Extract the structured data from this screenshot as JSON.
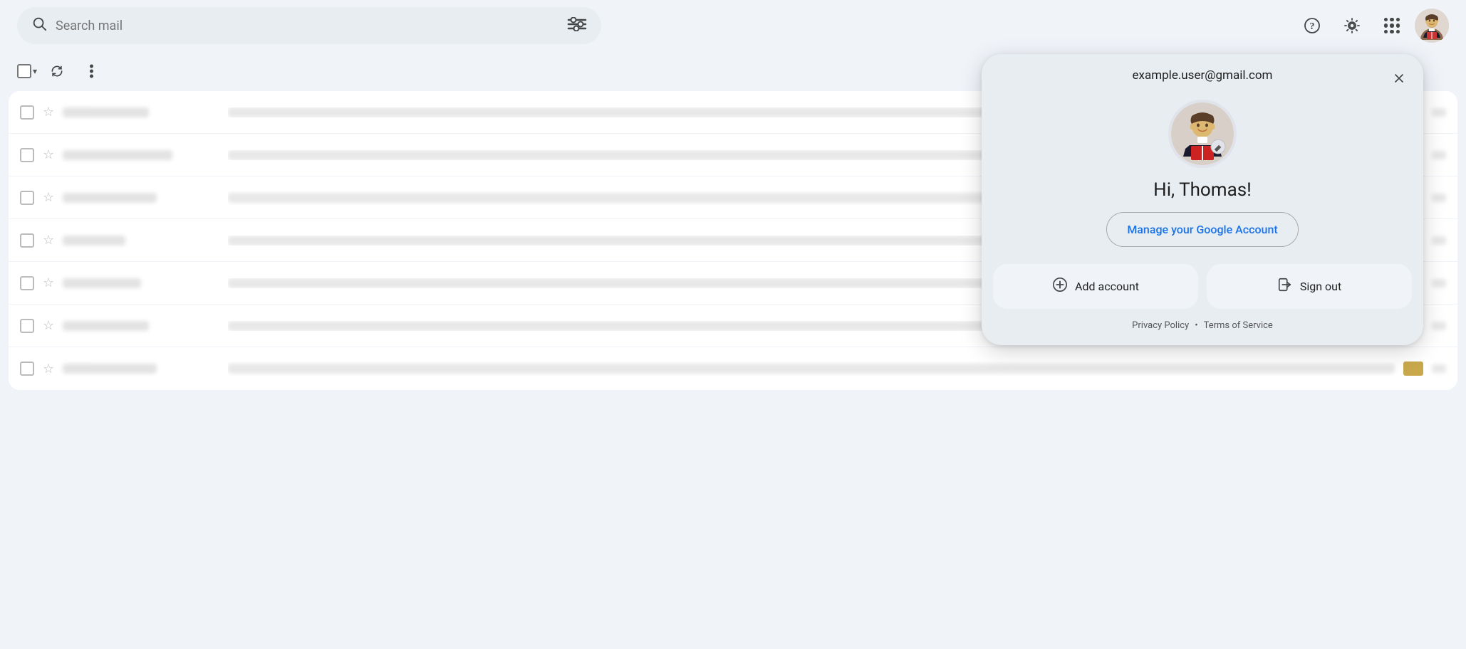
{
  "header": {
    "search_placeholder": "Search mail",
    "help_icon": "help-circle-icon",
    "settings_icon": "gear-icon",
    "apps_icon": "grid-icon",
    "avatar_icon": "user-avatar-icon"
  },
  "toolbar": {
    "checkbox_label": "Select",
    "refresh_label": "Refresh",
    "more_label": "More"
  },
  "email_rows": [
    {
      "id": 1,
      "tag_color": null
    },
    {
      "id": 2,
      "tag_color": null
    },
    {
      "id": 3,
      "tag_color": "#c8a84b"
    },
    {
      "id": 4,
      "tag_color": null
    },
    {
      "id": 5,
      "tag_color": null
    },
    {
      "id": 6,
      "tag_color": null
    },
    {
      "id": 7,
      "tag_color": "#c8a84b"
    }
  ],
  "account_dropdown": {
    "email": "example.user@gmail.com",
    "greeting": "Hi, Thomas!",
    "manage_account_label": "Manage your Google Account",
    "add_account_label": "Add account",
    "sign_out_label": "Sign out",
    "privacy_policy_label": "Privacy Policy",
    "terms_label": "Terms of Service",
    "dot_separator": "•"
  }
}
